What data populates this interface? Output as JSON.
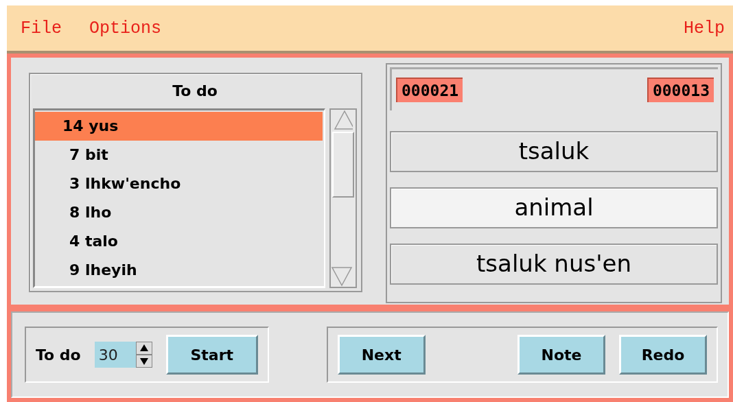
{
  "menu_bar": {
    "left": [
      {
        "label": "File"
      },
      {
        "label": "Options"
      }
    ],
    "right": [
      {
        "label": "Help"
      }
    ]
  },
  "todo_list": {
    "title": "To do",
    "items": [
      {
        "label": "14 yus",
        "selected": true
      },
      {
        "label": "7 bit",
        "selected": false
      },
      {
        "label": "3 lhkw'encho",
        "selected": false
      },
      {
        "label": "8 lho",
        "selected": false
      },
      {
        "label": "4 talo",
        "selected": false
      },
      {
        "label": "9 lheyih",
        "selected": false
      }
    ]
  },
  "counters": [
    "000021",
    "000013"
  ],
  "cards": [
    {
      "text": "tsaluk",
      "selected": false
    },
    {
      "text": "animal",
      "selected": true
    },
    {
      "text": "tsaluk nus'en",
      "selected": false
    }
  ],
  "controls": {
    "label": "To do",
    "spin_value": "30",
    "buttons": [
      "Start"
    ]
  },
  "actions": {
    "buttons": [
      "Next",
      "Note",
      "Redo"
    ]
  }
}
